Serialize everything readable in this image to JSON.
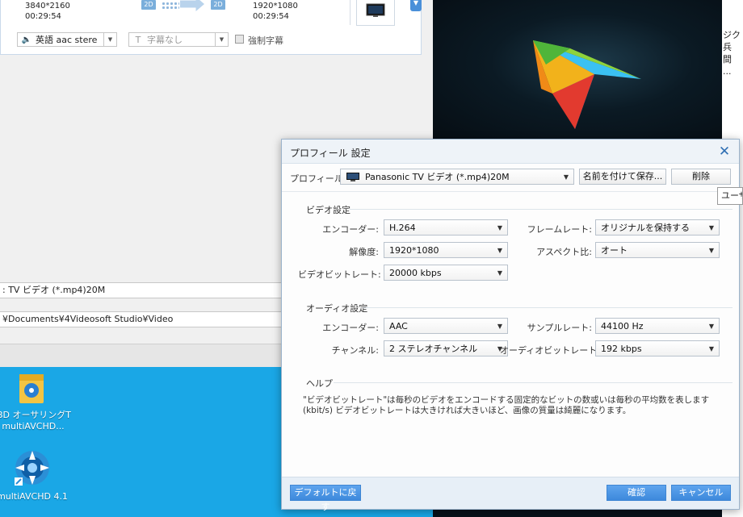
{
  "background_app": {
    "source": {
      "resolution": "3840*2160",
      "duration": "00:29:54",
      "badge": "2D"
    },
    "output": {
      "resolution": "1920*1080",
      "duration": "00:29:54",
      "badge": "2D"
    },
    "audio_track": "英語 aac stere",
    "subtitle": "字幕なし",
    "forced_subtitle": "強制字幕",
    "profile_bar": ": TV ビデオ (*.mp4)20M",
    "path_bar": "¥Documents¥4Videosoft Studio¥Video"
  },
  "right_strip": {
    "text_lines": [
      "ジク",
      "兵",
      "間",
      "..."
    ]
  },
  "desktop": {
    "icons": [
      {
        "label_lines": [
          "BD オーサリングT",
          "multiAVCHD..."
        ],
        "icon": "folder-app-icon"
      },
      {
        "label_lines": [
          "multiAVCHD 4.1"
        ],
        "icon": "multiavchd-app-icon"
      }
    ]
  },
  "dialog": {
    "title": "プロフィール 設定",
    "profile_label": "プロフィール:",
    "profile_value": "Panasonic TV ビデオ (*.mp4)20M",
    "save_as_label": "名前を付けて保存...",
    "delete_label": "削除",
    "video": {
      "section_title": "ビデオ設定",
      "encoder_label": "エンコーダー:",
      "encoder_value": "H.264",
      "framerate_label": "フレームレート:",
      "framerate_value": "オリジナルを保持する",
      "resolution_label": "解像度:",
      "resolution_value": "1920*1080",
      "aspect_label": "アスペクト比:",
      "aspect_value": "オート",
      "bitrate_label": "ビデオビットレート:",
      "bitrate_value": "20000 kbps"
    },
    "audio": {
      "section_title": "オーディオ設定",
      "encoder_label": "エンコーダー:",
      "encoder_value": "AAC",
      "samplerate_label": "サンプルレート:",
      "samplerate_value": "44100 Hz",
      "channel_label": "チャンネル:",
      "channel_value": "2 ステレオチャンネル",
      "bitrate_label": "オーディオビットレート:",
      "bitrate_value": "192 kbps"
    },
    "help": {
      "section_title": "ヘルプ",
      "line1": "\"ビデオビットレート\"は毎秒のビデオをエンコードする固定的なビットの数或いは毎秒の平均数を表します",
      "line2": "(kbit/s) ビデオビットレートは大きければ大きいほど、画像の質量は綺麗になります。"
    },
    "default_button": "デフォルトに戻す",
    "ok_button": "確認",
    "cancel_button": "キャンセル"
  },
  "tooltip": "ユーザ",
  "colors": {
    "accent": "#3d89dc",
    "desktop": "#1aa7e6",
    "close": "#2f6fb3"
  }
}
